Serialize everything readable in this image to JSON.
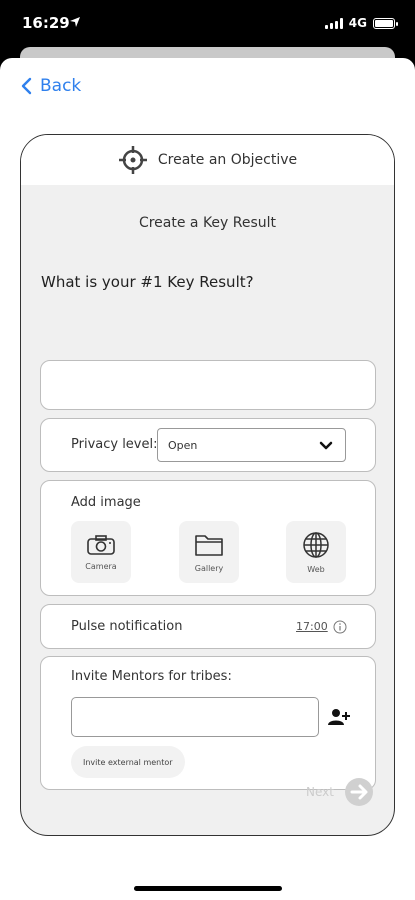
{
  "status_bar": {
    "time": "16:29",
    "network": "4G"
  },
  "nav": {
    "back_label": "Back"
  },
  "header": {
    "title": "Create an Objective"
  },
  "section_title": "Create a Key Result",
  "question": "What is your #1 Key Result?",
  "key_result_input": {
    "value": "",
    "placeholder": ""
  },
  "privacy": {
    "label": "Privacy level:",
    "selected": "Open"
  },
  "add_image": {
    "label": "Add image",
    "options": [
      {
        "label": "Camera",
        "icon": "camera-icon"
      },
      {
        "label": "Gallery",
        "icon": "folder-icon"
      },
      {
        "label": "Web",
        "icon": "globe-icon"
      }
    ]
  },
  "pulse": {
    "label": "Pulse notification",
    "time": "17:00"
  },
  "mentors": {
    "label": "Invite Mentors for tribes:",
    "input_value": "",
    "invite_external_label": "Invite external mentor"
  },
  "footer": {
    "next_label": "Next"
  },
  "colors": {
    "link": "#2f80ed",
    "panel_bg": "#f0f0f0",
    "disabled": "#cccccc"
  }
}
